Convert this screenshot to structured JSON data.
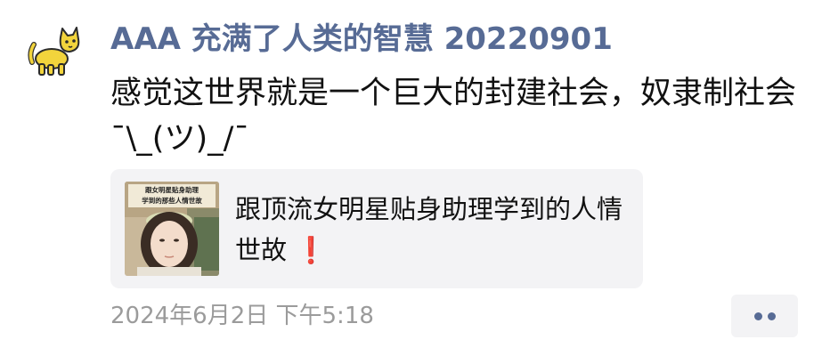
{
  "post": {
    "author": "AAA 充满了人类的智慧 20220901",
    "text": "感觉这世界就是一个巨大的封建社会，奴隶制社会¯\\_(ツ)_/¯",
    "link_card": {
      "thumbnail_caption": "跟女明星贴身助理学到的那些人情世故",
      "title": "跟顶流女明星贴身助理学到的人情世故",
      "title_emoji": "❗"
    },
    "timestamp": "2024年6月2日 下午5:18",
    "more_button_label": "••"
  },
  "colors": {
    "name_link": "#576b95",
    "text": "#111111",
    "meta": "#9b9b9b",
    "card_bg": "#f3f3f5",
    "avatar_cat": "#f2d43c",
    "emoji_red": "#e2251c"
  },
  "icons": {
    "avatar": "yellow-cat-icon",
    "more": "more-dots-icon"
  }
}
